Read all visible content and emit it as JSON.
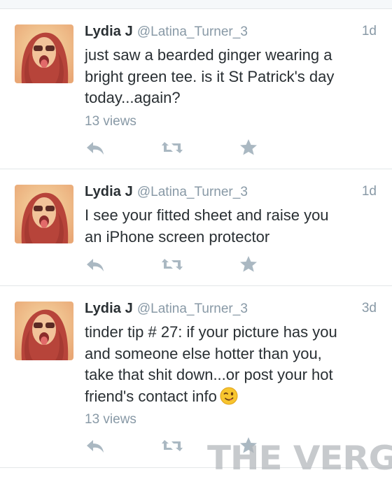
{
  "tweets": [
    {
      "name": "Lydia J",
      "handle": "@Latina_Turner_3",
      "time": "1d",
      "lines": [
        "just saw a bearded ginger wearing a",
        "bright green tee. is it St Patrick's day",
        "today...again?"
      ],
      "views": "13 views",
      "avatar_icon": "profile-photo"
    },
    {
      "name": "Lydia J",
      "handle": "@Latina_Turner_3",
      "time": "1d",
      "lines": [
        "I see your fitted sheet and raise you",
        "an iPhone screen protector"
      ],
      "views": "",
      "avatar_icon": "profile-photo"
    },
    {
      "name": "Lydia J",
      "handle": "@Latina_Turner_3",
      "time": "3d",
      "lines": [
        "tinder tip # 27:  if your picture has you",
        "and someone else hotter than you,",
        "take that shit down...or post your hot",
        "friend's contact info"
      ],
      "emoji": "winking-face-emoji",
      "views": "13 views",
      "avatar_icon": "profile-photo"
    }
  ],
  "actions": [
    "reply-icon",
    "retweet-icon",
    "favorite-icon"
  ],
  "colors": {
    "text": "#292f33",
    "muted": "#8899a6",
    "icon": "#aab8c2",
    "divider": "#e3e6e8"
  },
  "watermark": "THE VERGE"
}
